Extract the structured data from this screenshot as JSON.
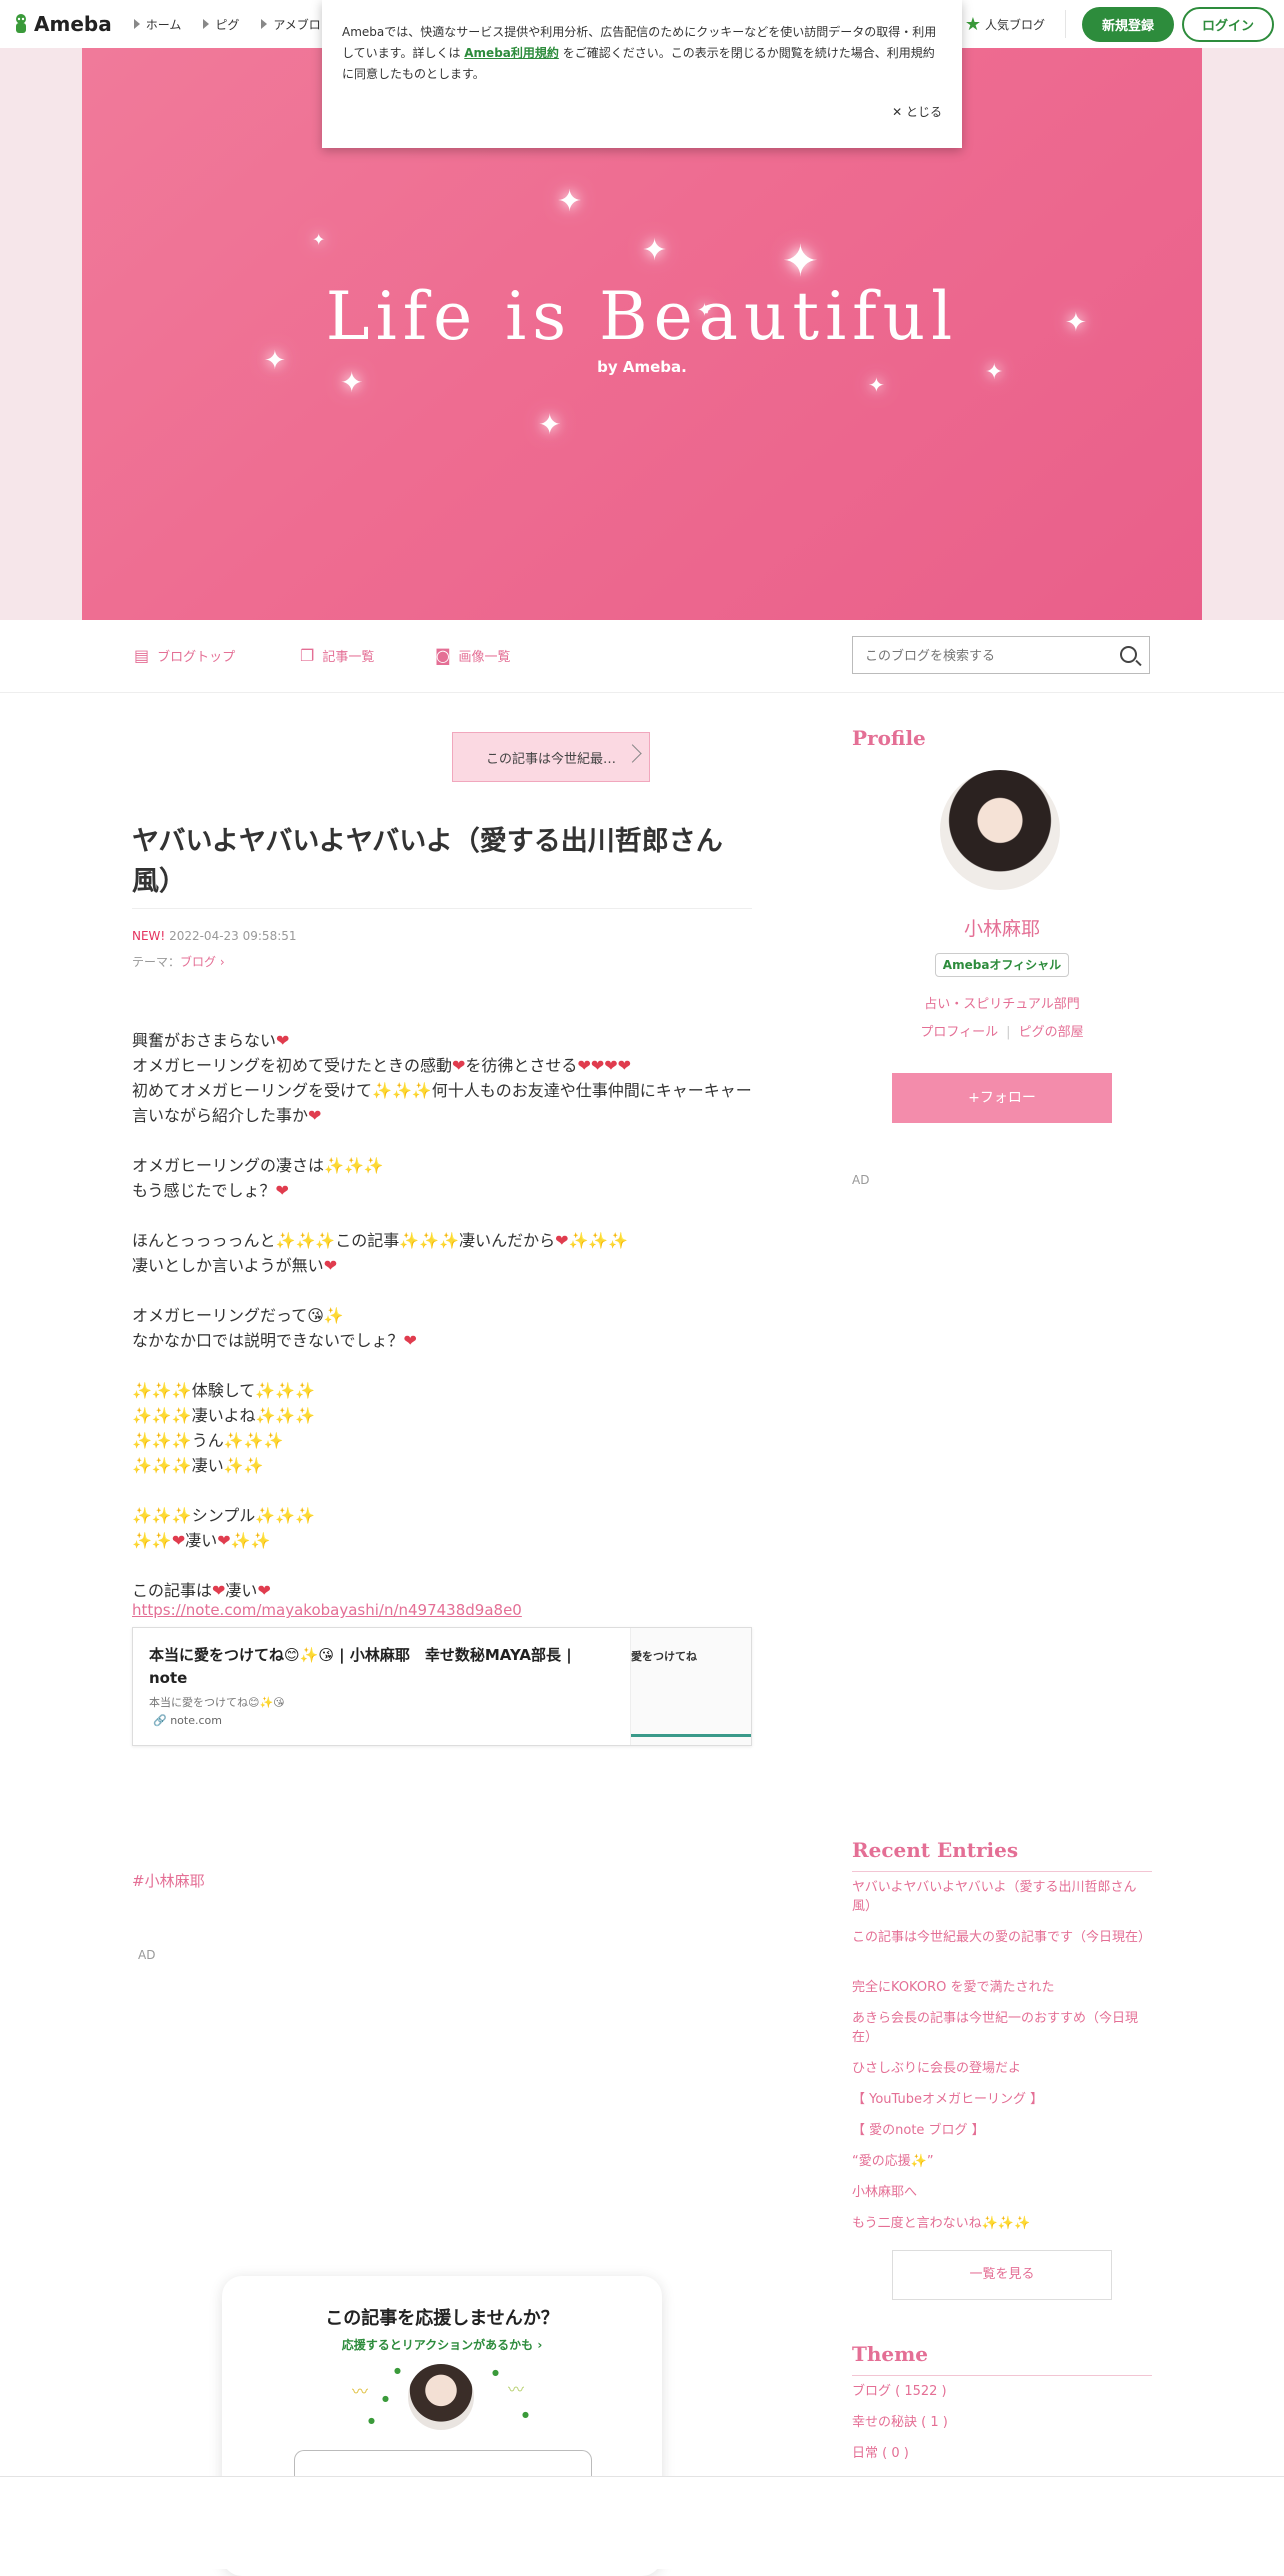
{
  "topnav": {
    "logo_text": "Ameba",
    "links": [
      "ホーム",
      "ピグ",
      "アメブロ"
    ],
    "popular": "人気ブログ",
    "register": "新規登録",
    "login": "ログイン"
  },
  "cookie": {
    "text_before": "Amebaでは、快適なサービス提供や利用分析、広告配信のためにクッキーなどを使い訪問データの取得・利用しています。詳しくは ",
    "terms_link": "Ameba利用規約",
    "text_after": " をご確認ください。この表示を閉じるか閲覧を続けた場合、利用規約に同意したものとします。",
    "close": "とじる"
  },
  "hero": {
    "title": "Life is Beautiful",
    "byline": "by Ameba."
  },
  "blognav": {
    "top": "ブログトップ",
    "list": "記事一覧",
    "images": "画像一覧",
    "search_placeholder": "このブログを検索する"
  },
  "article": {
    "next_label": "この記事は今世紀最…",
    "title": "ヤバいよヤバいよヤバいよ（愛する出川哲郎さん風）",
    "new_badge": "NEW!",
    "date": "2022-04-23 09:58:51",
    "theme_label": "テーマ：",
    "theme_value": "ブログ",
    "url": "https://note.com/mayakobayashi/n/n497438d9a8e0",
    "card_title": "本当に愛をつけてね😊✨😘 | 小林麻耶　幸せ数秘MAYA部長 | note",
    "card_desc": "本当に愛をつけてね😊✨😘",
    "card_site": "note.com",
    "card_thumb_text": "愛をつけてね",
    "hashtag": "#小林麻耶",
    "ad": "AD"
  },
  "support": {
    "heading": "この記事を応援しませんか？",
    "sub": "応援するとリアクションがあるかも ›"
  },
  "sidebar": {
    "profile_heading": "Profile",
    "name": "小林麻耶",
    "badge": "Amebaオフィシャル",
    "category": "占い・スピリチュアル部門",
    "link_profile": "プロフィール",
    "link_room": "ピグの部屋",
    "follow": "+フォロー",
    "ad": "AD",
    "recent_heading": "Recent Entries",
    "recent": [
      "ヤバいよヤバいよヤバいよ（愛する出川哲郎さん風）",
      "この記事は今世紀最大の愛の記事です（今日現在）",
      "完全にKOKORO を愛で満たされた",
      "あきら会長の記事は今世紀一のおすすめ（今日現在）",
      "ひさしぶりに会長の登場だよ",
      "【 YouTubeオメガヒーリング 】",
      "【 愛のnote ブログ 】",
      "“愛の応援✨”",
      "小林麻耶へ",
      "もう二度と言わないね✨✨✨"
    ],
    "more": "一覧を見る",
    "theme_heading": "Theme",
    "themes": [
      "ブログ ( 1522 )",
      "幸せの秘訣 ( 1 )",
      "日常 ( 0 )"
    ]
  },
  "colors": {
    "accent": "#e46f95",
    "hero": "#ee6c91",
    "brand_green": "#2d8c3c",
    "follow": "#f38cab"
  }
}
